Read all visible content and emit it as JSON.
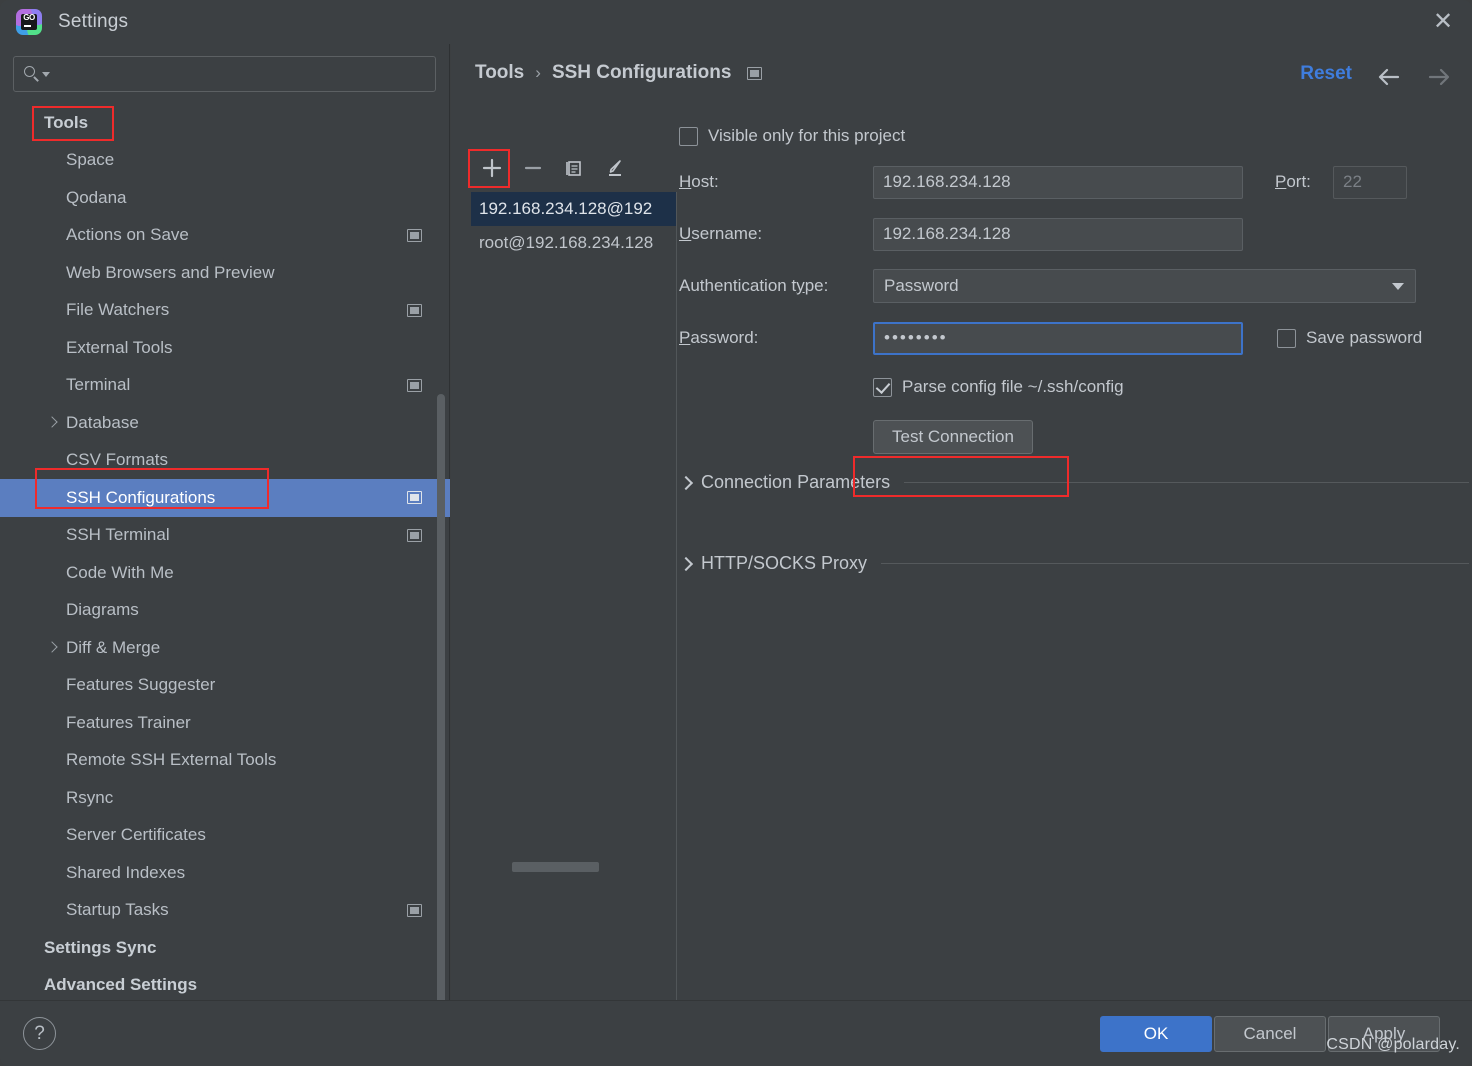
{
  "window": {
    "title": "Settings",
    "app_icon": "goland-icon",
    "close_label": "✕"
  },
  "sidebar": {
    "search": {
      "value": "",
      "placeholder": ""
    },
    "items": [
      {
        "label": "Tools",
        "level": "top",
        "scope_icon": false,
        "expandable": false,
        "selected": false
      },
      {
        "label": "Space",
        "level": "child",
        "scope_icon": false,
        "expandable": false,
        "selected": false
      },
      {
        "label": "Qodana",
        "level": "child",
        "scope_icon": false,
        "expandable": false,
        "selected": false
      },
      {
        "label": "Actions on Save",
        "level": "child",
        "scope_icon": true,
        "expandable": false,
        "selected": false
      },
      {
        "label": "Web Browsers and Preview",
        "level": "child",
        "scope_icon": false,
        "expandable": false,
        "selected": false
      },
      {
        "label": "File Watchers",
        "level": "child",
        "scope_icon": true,
        "expandable": false,
        "selected": false
      },
      {
        "label": "External Tools",
        "level": "child",
        "scope_icon": false,
        "expandable": false,
        "selected": false
      },
      {
        "label": "Terminal",
        "level": "child",
        "scope_icon": true,
        "expandable": false,
        "selected": false
      },
      {
        "label": "Database",
        "level": "child",
        "scope_icon": false,
        "expandable": true,
        "selected": false
      },
      {
        "label": "CSV Formats",
        "level": "child",
        "scope_icon": false,
        "expandable": false,
        "selected": false
      },
      {
        "label": "SSH Configurations",
        "level": "child",
        "scope_icon": true,
        "expandable": false,
        "selected": true
      },
      {
        "label": "SSH Terminal",
        "level": "child",
        "scope_icon": true,
        "expandable": false,
        "selected": false
      },
      {
        "label": "Code With Me",
        "level": "child",
        "scope_icon": false,
        "expandable": false,
        "selected": false
      },
      {
        "label": "Diagrams",
        "level": "child",
        "scope_icon": false,
        "expandable": false,
        "selected": false
      },
      {
        "label": "Diff & Merge",
        "level": "child",
        "scope_icon": false,
        "expandable": true,
        "selected": false
      },
      {
        "label": "Features Suggester",
        "level": "child",
        "scope_icon": false,
        "expandable": false,
        "selected": false
      },
      {
        "label": "Features Trainer",
        "level": "child",
        "scope_icon": false,
        "expandable": false,
        "selected": false
      },
      {
        "label": "Remote SSH External Tools",
        "level": "child",
        "scope_icon": false,
        "expandable": false,
        "selected": false
      },
      {
        "label": "Rsync",
        "level": "child",
        "scope_icon": false,
        "expandable": false,
        "selected": false
      },
      {
        "label": "Server Certificates",
        "level": "child",
        "scope_icon": false,
        "expandable": false,
        "selected": false
      },
      {
        "label": "Shared Indexes",
        "level": "child",
        "scope_icon": false,
        "expandable": false,
        "selected": false
      },
      {
        "label": "Startup Tasks",
        "level": "child",
        "scope_icon": true,
        "expandable": false,
        "selected": false
      },
      {
        "label": "Settings Sync",
        "level": "top",
        "scope_icon": false,
        "expandable": false,
        "selected": false
      },
      {
        "label": "Advanced Settings",
        "level": "top",
        "scope_icon": false,
        "expandable": false,
        "selected": false
      }
    ]
  },
  "breadcrumb": {
    "root": "Tools",
    "separator": "›",
    "current": "SSH Configurations"
  },
  "header": {
    "reset_label": "Reset",
    "back_icon": "arrow-left-icon",
    "forward_icon": "arrow-right-icon"
  },
  "config_toolbar": {
    "add_label": "+",
    "remove_label": "−",
    "copy_label": "copy-icon",
    "edit_label": "pencil-icon"
  },
  "config_list": {
    "items": [
      {
        "label": "192.168.234.128@192",
        "selected": true
      },
      {
        "label": "root@192.168.234.128",
        "selected": false
      }
    ]
  },
  "form": {
    "visible_only_checkbox": {
      "label": "Visible only for this project",
      "checked": false
    },
    "host": {
      "label": "Host:",
      "value": "192.168.234.128"
    },
    "port": {
      "label": "Port:",
      "value": "22",
      "disabled": true
    },
    "username": {
      "label": "Username:",
      "value": "192.168.234.128"
    },
    "auth_type": {
      "label": "Authentication type:",
      "value": "Password"
    },
    "password": {
      "label": "Password:",
      "value": "••••••••"
    },
    "save_password_checkbox": {
      "label": "Save password",
      "checked": false
    },
    "parse_config_checkbox": {
      "label": "Parse config file ~/.ssh/config",
      "checked": true
    },
    "test_connection_button": "Test Connection",
    "sections": [
      {
        "label": "Connection Parameters",
        "expanded": false
      },
      {
        "label": "HTTP/SOCKS Proxy",
        "expanded": false
      }
    ]
  },
  "footer": {
    "help_label": "?",
    "ok_label": "OK",
    "cancel_label": "Cancel",
    "apply_label": "Apply"
  },
  "watermark": "CSDN @polarday.",
  "colors": {
    "accent_blue": "#3d73c9",
    "selection_blue": "#5b7ec0",
    "list_selection": "#1d3048",
    "highlight_red": "#ef2b2b",
    "panel_bg": "#3c4043",
    "text": "#c3c8ce"
  }
}
